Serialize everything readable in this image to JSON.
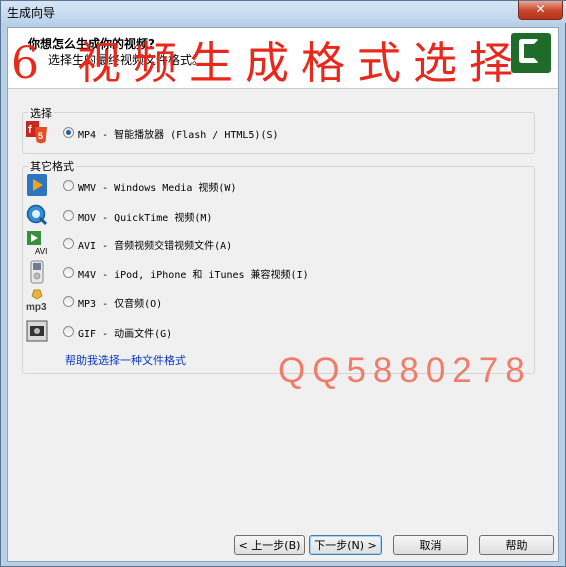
{
  "window": {
    "title": "生成向导",
    "close_glyph": "✕"
  },
  "header": {
    "title": "你想怎么生成你的视频?",
    "subtitle": "选择生的最终视频文件格式。"
  },
  "overlay": {
    "title": "6 视频生成格式选择",
    "qq": "QQ5880278"
  },
  "choose_group": {
    "label": "选择",
    "option": {
      "label": "MP4 - 智能播放器 (Flash / HTML5)(S)",
      "checked": true,
      "icon": "html5-flash-icon"
    }
  },
  "other_group": {
    "label": "其它格式",
    "options": [
      {
        "label": "WMV - Windows Media 视频(W)",
        "icon": "windows-media-icon"
      },
      {
        "label": "MOV - QuickTime 视频(M)",
        "icon": "quicktime-icon"
      },
      {
        "label": "AVI - 音频视频交错视频文件(A)",
        "icon": "avi-icon"
      },
      {
        "label": "M4V - iPod, iPhone 和 iTunes 兼容视频(I)",
        "icon": "ipod-icon"
      },
      {
        "label": "MP3 - 仅音频(O)",
        "icon": "mp3-icon"
      },
      {
        "label": "GIF - 动画文件(G)",
        "icon": "gif-icon"
      }
    ]
  },
  "help_link": "帮助我选择一种文件格式",
  "buttons": {
    "back": "< 上一步(B)",
    "next": "下一步(N) >",
    "cancel": "取消",
    "help": "帮助"
  },
  "colors": {
    "overlay_red": "#e8281b",
    "link_blue": "#0a36c9",
    "logo_green": "#1f6b2a"
  }
}
